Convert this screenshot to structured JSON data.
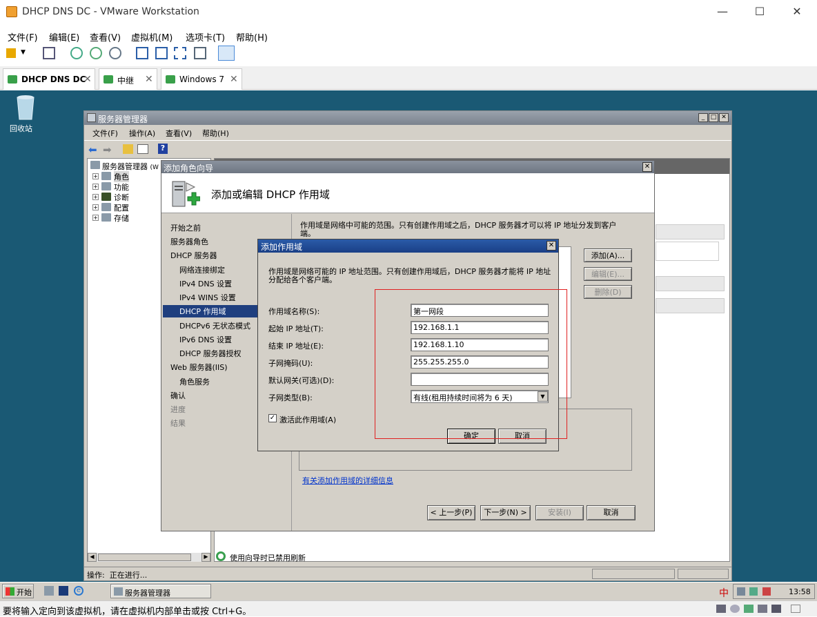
{
  "vmware": {
    "title": "DHCP DNS DC - VMware Workstation",
    "menu": [
      "文件(F)",
      "编辑(E)",
      "查看(V)",
      "虚拟机(M)",
      "选项卡(T)",
      "帮助(H)"
    ],
    "tabs": [
      "DHCP DNS DC",
      "中继",
      "Windows 7"
    ],
    "status": "要将输入定向到该虚拟机，请在虚拟机内部单击或按 Ctrl+G。"
  },
  "desktop": {
    "recycle_bin": "回收站"
  },
  "server_manager": {
    "title": "服务器管理器",
    "menu": [
      "文件(F)",
      "操作(A)",
      "查看(V)",
      "帮助(H)"
    ],
    "tree": {
      "root": "服务器管理器",
      "root_suffix": "(W",
      "items": [
        "角色",
        "功能",
        "诊断",
        "配置",
        "存储"
      ]
    },
    "status_label": "操作:",
    "status_value": "正在进行...",
    "refresh_note": "使用向导时已禁用刷新"
  },
  "wizard": {
    "title": "添加角色向导",
    "heading": "添加或编辑 DHCP 作用域",
    "nav": [
      "开始之前",
      "服务器角色",
      "DHCP 服务器",
      "网络连接绑定",
      "IPv4 DNS 设置",
      "IPv4 WINS 设置",
      "DHCP 作用域",
      "DHCPv6 无状态模式",
      "IPv6 DNS 设置",
      "DHCP 服务器授权",
      "Web 服务器(IIS)",
      "角色服务",
      "确认",
      "进度",
      "结果"
    ],
    "description": "作用域是网络中可能的范围。只有创建作用域之后，DHCP 服务器才可以将 IP 地址分发到客户端。",
    "buttons": {
      "add": "添加(A)...",
      "edit": "编辑(E)...",
      "delete": "删除(D)"
    },
    "link": "有关添加作用域的详细信息",
    "footer": {
      "prev": "< 上一步(P)",
      "next": "下一步(N) >",
      "install": "安装(I)",
      "cancel": "取消"
    }
  },
  "dialog": {
    "title": "添加作用域",
    "description": "作用域是网络可能的 IP 地址范围。只有创建作用域后，DHCP 服务器才能将 IP 地址分配给各个客户端。",
    "fields": [
      {
        "label": "作用域名称(S):",
        "value": "第一网段"
      },
      {
        "label": "起始 IP 地址(T):",
        "value": "192.168.1.1"
      },
      {
        "label": "结束 IP 地址(E):",
        "value": "192.168.1.10"
      },
      {
        "label": "子网掩码(U):",
        "value": "255.255.255.0"
      },
      {
        "label": "默认网关(可选)(D):",
        "value": ""
      },
      {
        "label": "子网类型(B):",
        "value": "有线(租用持续时间将为 6 天)"
      }
    ],
    "activate_label": "激活此作用域(A)",
    "activate_checked": true,
    "ok": "确定",
    "cancel": "取消"
  },
  "taskbar": {
    "start": "开始",
    "task": "服务器管理器",
    "ime": "中",
    "clock": "13:58"
  }
}
